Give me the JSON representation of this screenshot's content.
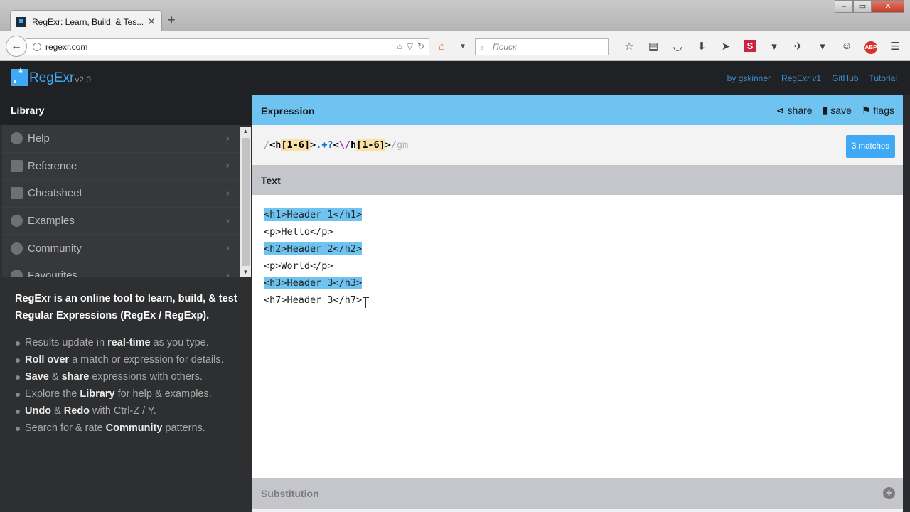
{
  "browser": {
    "tab_title": "RegExr: Learn, Build, & Tes...",
    "tab_close": "✕",
    "new_tab": "+",
    "url": "regexr.com",
    "search_placeholder": "Поиск",
    "window_controls": [
      "‒",
      "▭",
      "✕"
    ]
  },
  "app": {
    "logo_name": "RegExr",
    "logo_version": "v2.0",
    "top_links": [
      "by gskinner",
      "RegExr v1",
      "GitHub",
      "Tutorial"
    ]
  },
  "sidebar": {
    "title": "Library",
    "items": [
      {
        "label": "Help",
        "icon": "help-icon"
      },
      {
        "label": "Reference",
        "icon": "book-icon"
      },
      {
        "label": "Cheatsheet",
        "icon": "clipboard-icon"
      },
      {
        "label": "Examples",
        "icon": "lightbulb-icon"
      },
      {
        "label": "Community",
        "icon": "people-icon"
      },
      {
        "label": "Favourites",
        "icon": "heart-icon"
      }
    ],
    "intro": "RegExr is an online tool to learn, build, & test Regular Expressions (RegEx / RegExp).",
    "tips": [
      {
        "pre": "Results update in ",
        "bold": "real-time",
        "post": " as you type."
      },
      {
        "pre": "",
        "bold": "Roll over",
        "post": " a match or expression for details."
      },
      {
        "pre": "",
        "bold": "Save",
        "mid": " & ",
        "bold2": "share",
        "post": " expressions with others."
      },
      {
        "pre": "Explore the ",
        "bold": "Library",
        "post": " for help & examples."
      },
      {
        "pre": "",
        "bold": "Undo",
        "mid": " & ",
        "bold2": "Redo",
        "post": " with Ctrl-Z / Y."
      },
      {
        "pre": "Search for & rate ",
        "bold": "Community",
        "post": " patterns."
      }
    ]
  },
  "expression": {
    "title": "Expression",
    "actions": {
      "share": "share",
      "save": "save",
      "flags": "flags"
    },
    "tokens": {
      "open_slash": "/",
      "t1": "<h",
      "set1": "[1-6]",
      "t2": ">",
      "quant": ".+?",
      "t3": "<",
      "esc": "\\/",
      "t4": "h",
      "set2": "[1-6]",
      "t5": ">",
      "close": "/",
      "flags": "gm"
    },
    "matches": "3 matches"
  },
  "text": {
    "title": "Text",
    "lines": [
      {
        "text": "<h1>Header 1</h1>",
        "match": true
      },
      {
        "text": "<p>Hello</p>",
        "match": false
      },
      {
        "text": "<h2>Header 2</h2>",
        "match": true
      },
      {
        "text": "<p>World</p>",
        "match": false
      },
      {
        "text": "<h3>Header 3</h3>",
        "match": true
      },
      {
        "text": "<h7>Header 3</h7>",
        "match": false
      }
    ]
  },
  "substitution": {
    "title": "Substitution",
    "toggle": "+"
  },
  "colors": {
    "accent": "#3fa9f5",
    "expression_bar": "#6ec3f0",
    "match_highlight": "#6ec3f0",
    "set_highlight": "#f8e0a6",
    "sidebar_bg": "#2e2f31"
  }
}
